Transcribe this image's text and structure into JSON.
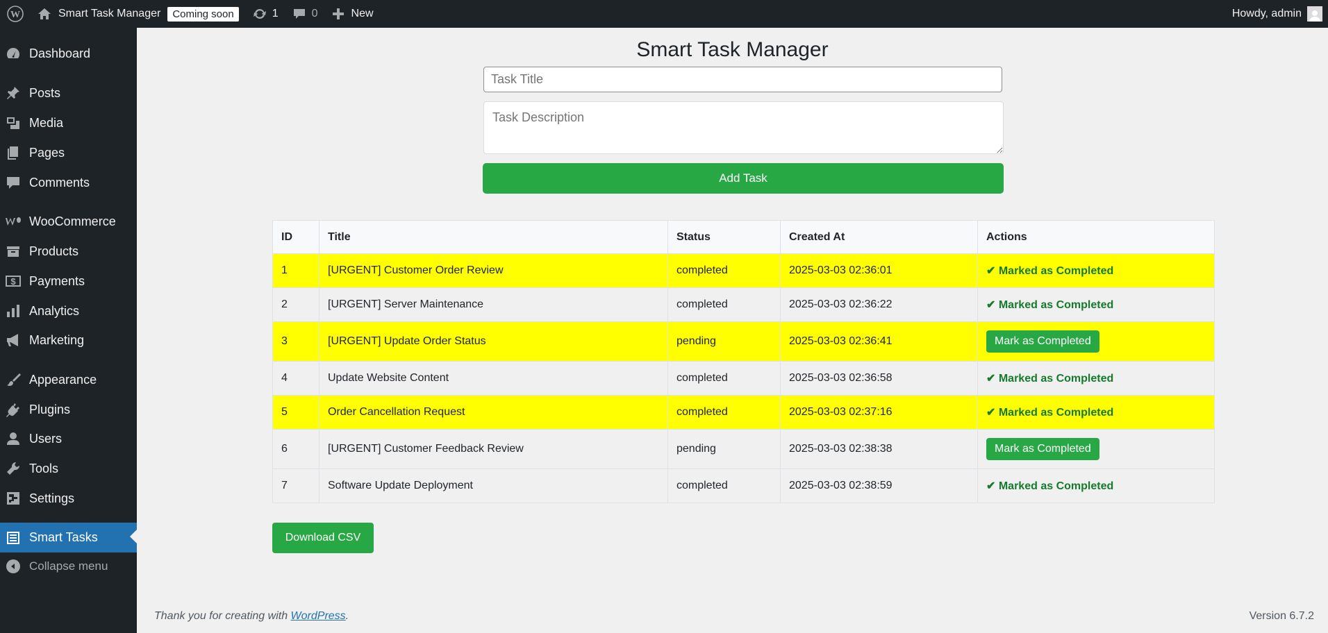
{
  "adminbar": {
    "site_name": "Smart Task Manager",
    "coming_soon": "Coming soon",
    "updates_count": "1",
    "comments_count": "0",
    "new_label": "New",
    "howdy": "Howdy, admin"
  },
  "sidebar": {
    "items": [
      {
        "label": "Dashboard",
        "icon": "dashboard-icon"
      },
      {
        "label": "Posts",
        "icon": "pin-icon"
      },
      {
        "label": "Media",
        "icon": "media-icon"
      },
      {
        "label": "Pages",
        "icon": "pages-icon"
      },
      {
        "label": "Comments",
        "icon": "comment-icon"
      },
      {
        "label": "WooCommerce",
        "icon": "woocommerce-icon"
      },
      {
        "label": "Products",
        "icon": "archive-icon"
      },
      {
        "label": "Payments",
        "icon": "dollar-icon"
      },
      {
        "label": "Analytics",
        "icon": "bar-chart-icon"
      },
      {
        "label": "Marketing",
        "icon": "megaphone-icon"
      },
      {
        "label": "Appearance",
        "icon": "brush-icon"
      },
      {
        "label": "Plugins",
        "icon": "plug-icon"
      },
      {
        "label": "Users",
        "icon": "user-icon"
      },
      {
        "label": "Tools",
        "icon": "wrench-icon"
      },
      {
        "label": "Settings",
        "icon": "settings-icon"
      },
      {
        "label": "Smart Tasks",
        "icon": "list-icon",
        "active": true
      }
    ],
    "collapse_label": "Collapse menu"
  },
  "main": {
    "title": "Smart Task Manager",
    "task_title_placeholder": "Task Title",
    "task_desc_placeholder": "Task Description",
    "add_task_label": "Add Task",
    "table": {
      "headers": [
        "ID",
        "Title",
        "Status",
        "Created At",
        "Actions"
      ],
      "rows": [
        {
          "id": "1",
          "title": "[URGENT] Customer Order Review",
          "status": "completed",
          "created": "2025-03-03 02:36:01",
          "action": "✔ Marked as Completed",
          "highlight": true
        },
        {
          "id": "2",
          "title": "[URGENT] Server Maintenance",
          "status": "completed",
          "created": "2025-03-03 02:36:22",
          "action": "✔ Marked as Completed",
          "highlight": false
        },
        {
          "id": "3",
          "title": "[URGENT] Update Order Status",
          "status": "pending",
          "created": "2025-03-03 02:36:41",
          "action": "Mark as Completed",
          "highlight": true
        },
        {
          "id": "4",
          "title": "Update Website Content",
          "status": "completed",
          "created": "2025-03-03 02:36:58",
          "action": "✔ Marked as Completed",
          "highlight": false
        },
        {
          "id": "5",
          "title": "Order Cancellation Request",
          "status": "completed",
          "created": "2025-03-03 02:37:16",
          "action": "✔ Marked as Completed",
          "highlight": true
        },
        {
          "id": "6",
          "title": "[URGENT] Customer Feedback Review",
          "status": "pending",
          "created": "2025-03-03 02:38:38",
          "action": "Mark as Completed",
          "highlight": false
        },
        {
          "id": "7",
          "title": "Software Update Deployment",
          "status": "completed",
          "created": "2025-03-03 02:38:59",
          "action": "✔ Marked as Completed",
          "highlight": false
        }
      ]
    },
    "download_csv_label": "Download CSV"
  },
  "footer": {
    "thanks_prefix": "Thank you for creating with ",
    "wordpress_link": "WordPress",
    "thanks_suffix": ".",
    "version": "Version 6.7.2"
  },
  "colors": {
    "adminbar_bg": "#1d2327",
    "active_menu": "#2271b1",
    "button_green": "#28a745",
    "highlight_yellow": "#ffff00",
    "completed_text": "#157a2b"
  }
}
